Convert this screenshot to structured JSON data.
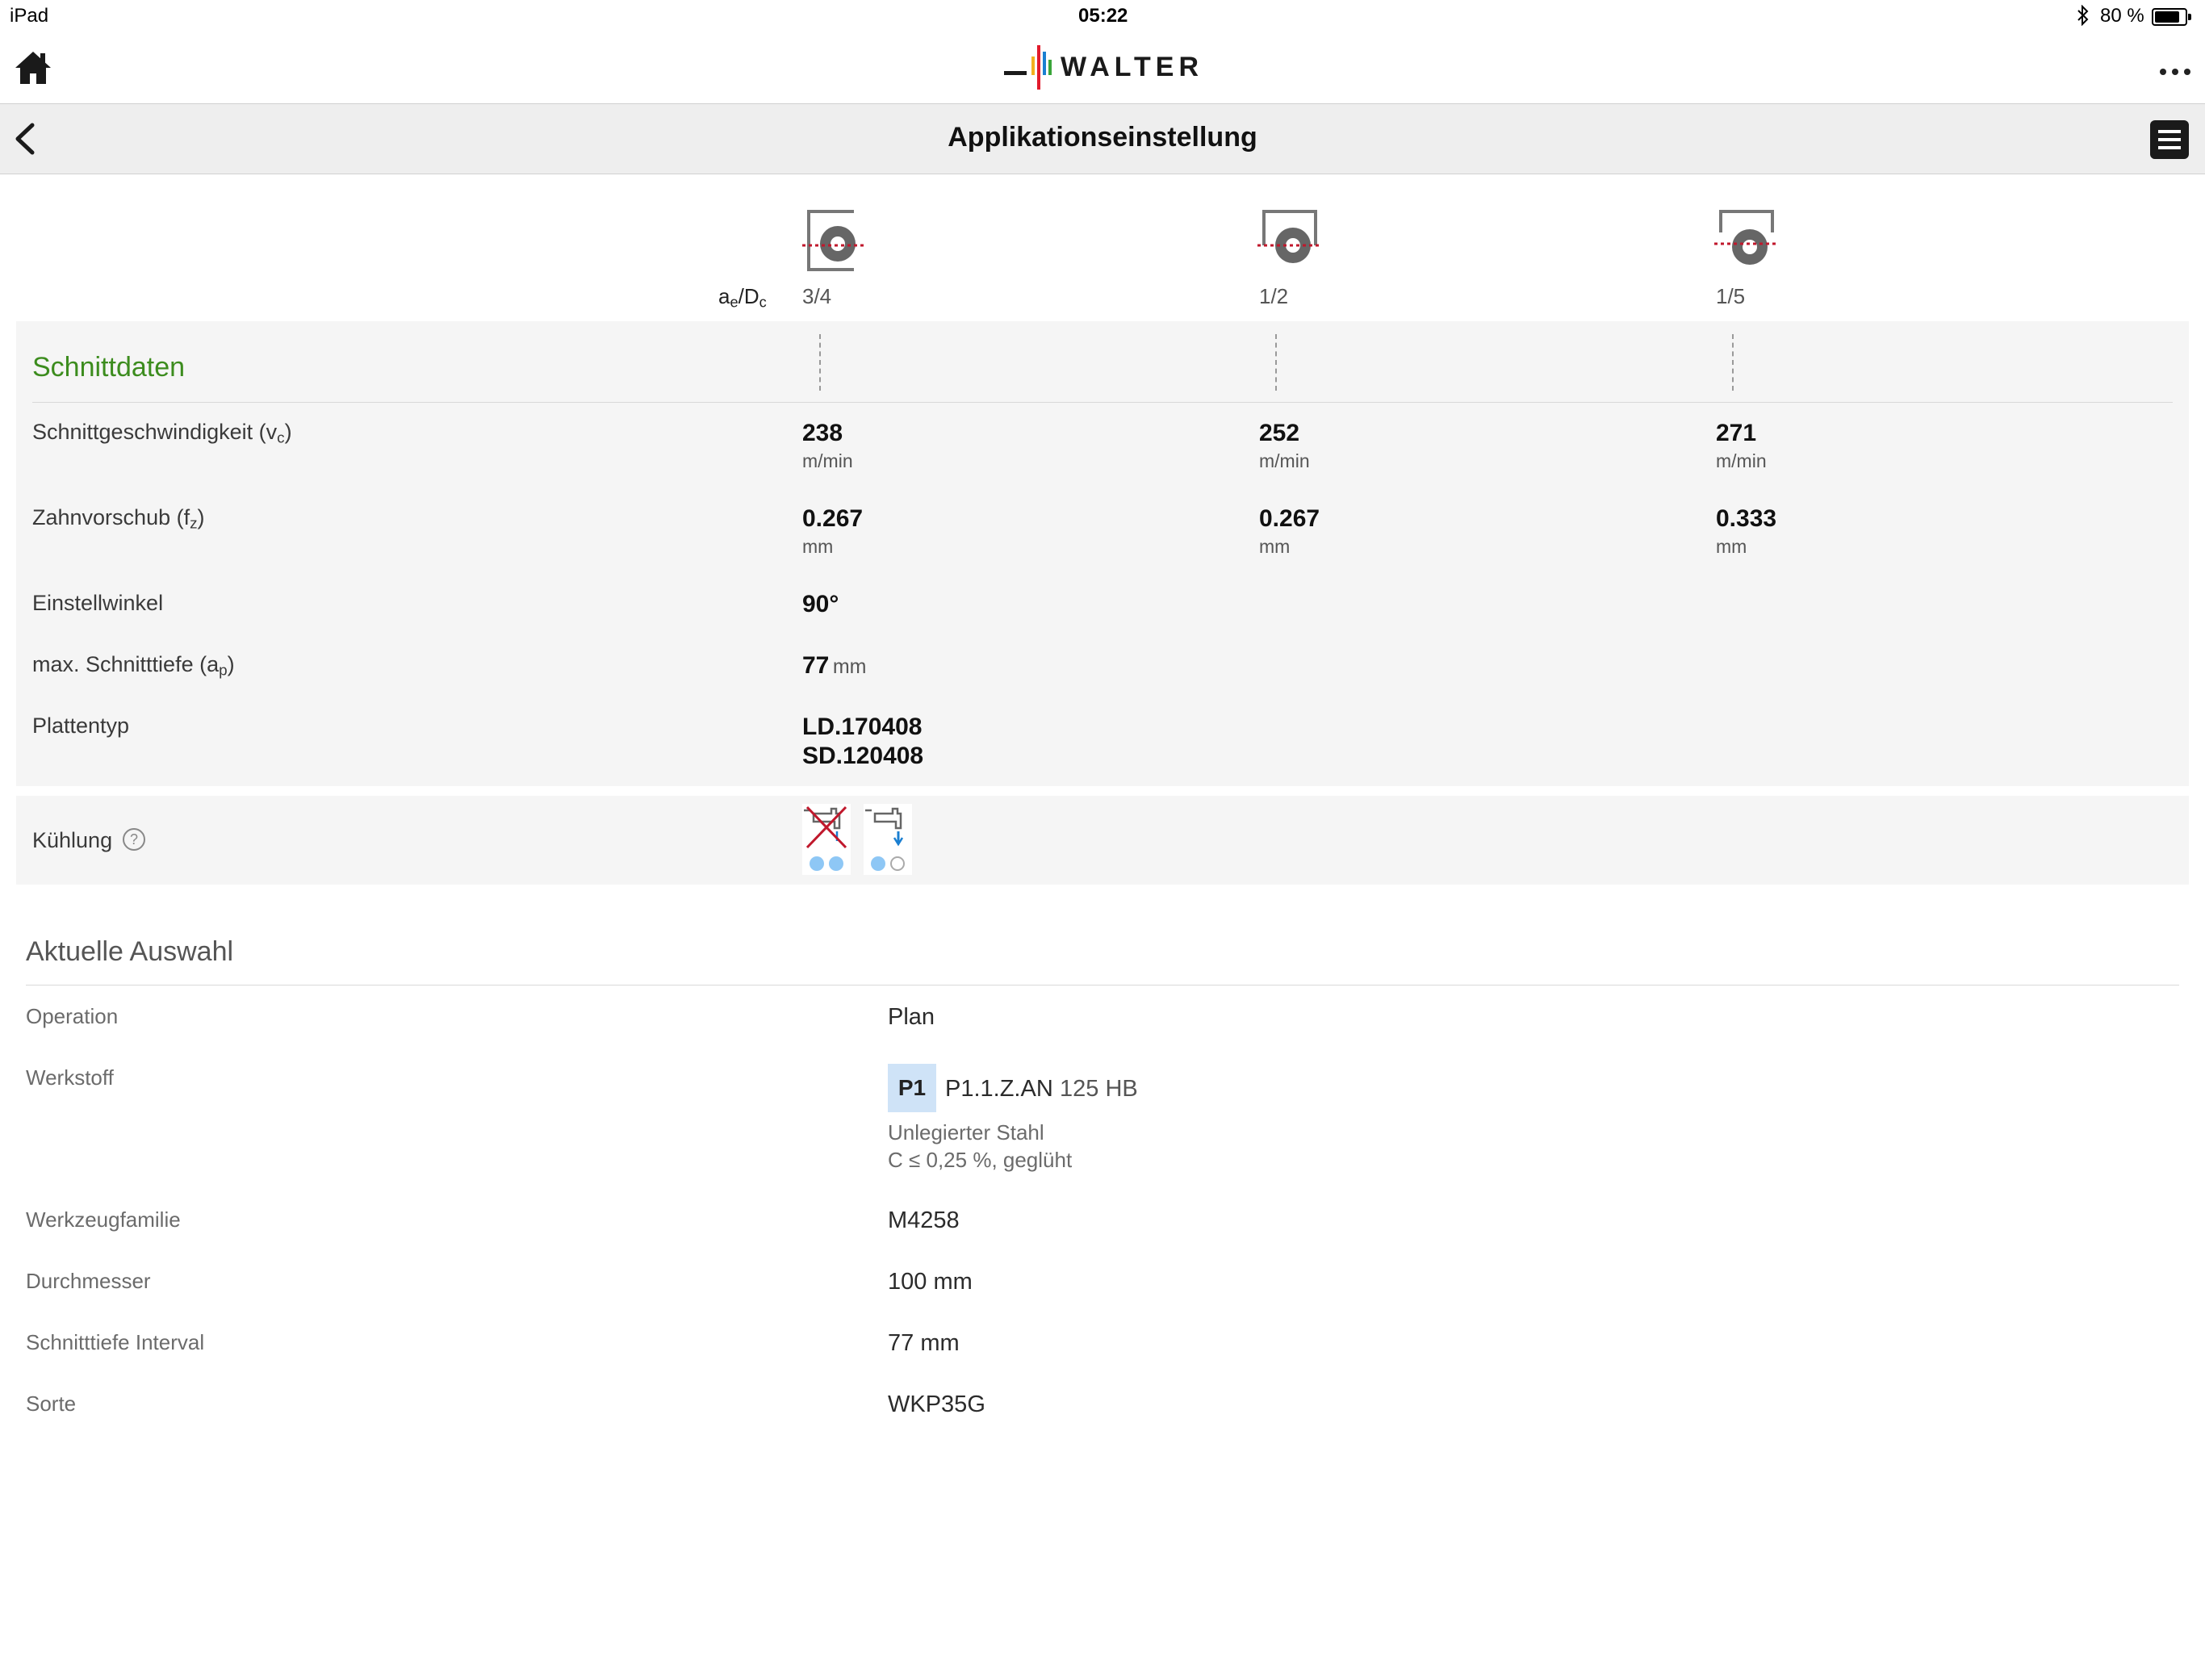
{
  "status_bar": {
    "device": "iPad",
    "time": "05:22",
    "battery": "80 %",
    "battery_level": 0.8
  },
  "header": {
    "logo_text": "WALTER"
  },
  "titlebar": {
    "title": "Applikationseinstellung"
  },
  "columns": [
    {
      "ratio": "3/4"
    },
    {
      "ratio": "1/2"
    },
    {
      "ratio": "1/5"
    }
  ],
  "ratio_label": {
    "main": "a",
    "sub1": "e",
    "sep": "/D",
    "sub2": "c"
  },
  "schnittdaten": {
    "title": "Schnittdaten",
    "vc": {
      "label": "Schnittgeschwindigkeit (v",
      "sub": "c",
      "close": ")",
      "values": [
        "238",
        "252",
        "271"
      ],
      "unit": "m/min"
    },
    "fz": {
      "label": "Zahnvorschub (f",
      "sub": "z",
      "close": ")",
      "values": [
        "0.267",
        "0.267",
        "0.333"
      ],
      "unit": "mm"
    },
    "einstellwinkel": {
      "label": "Einstellwinkel",
      "value": "90°"
    },
    "ap": {
      "label": "max. Schnitttiefe (a",
      "sub": "p",
      "close": ")",
      "value": "77",
      "unit": "mm"
    },
    "plattentyp": {
      "label": "Plattentyp",
      "values": [
        "LD.170408",
        "SD.120408"
      ]
    }
  },
  "kuehlung": {
    "label": "Kühlung",
    "help": "?"
  },
  "auswahl": {
    "title": "Aktuelle Auswahl",
    "operation": {
      "label": "Operation",
      "value": "Plan"
    },
    "werkstoff": {
      "label": "Werkstoff",
      "badge": "P1",
      "code": "P1.1.Z.AN",
      "hardness": "125 HB",
      "desc1": "Unlegierter Stahl",
      "desc2": "C ≤ 0,25 %, geglüht"
    },
    "familie": {
      "label": "Werkzeugfamilie",
      "value": "M4258"
    },
    "durchmesser": {
      "label": "Durchmesser",
      "value": "100 mm"
    },
    "schnitttiefe": {
      "label": "Schnitttiefe Interval",
      "value": "77 mm"
    },
    "sorte": {
      "label": "Sorte",
      "value": "WKP35G"
    }
  },
  "colors": {
    "accent_green": "#3c8c1e",
    "badge_bg": "#cfe3f7",
    "dot_blue": "#8ec7f5",
    "cross_red": "#c0182c"
  }
}
